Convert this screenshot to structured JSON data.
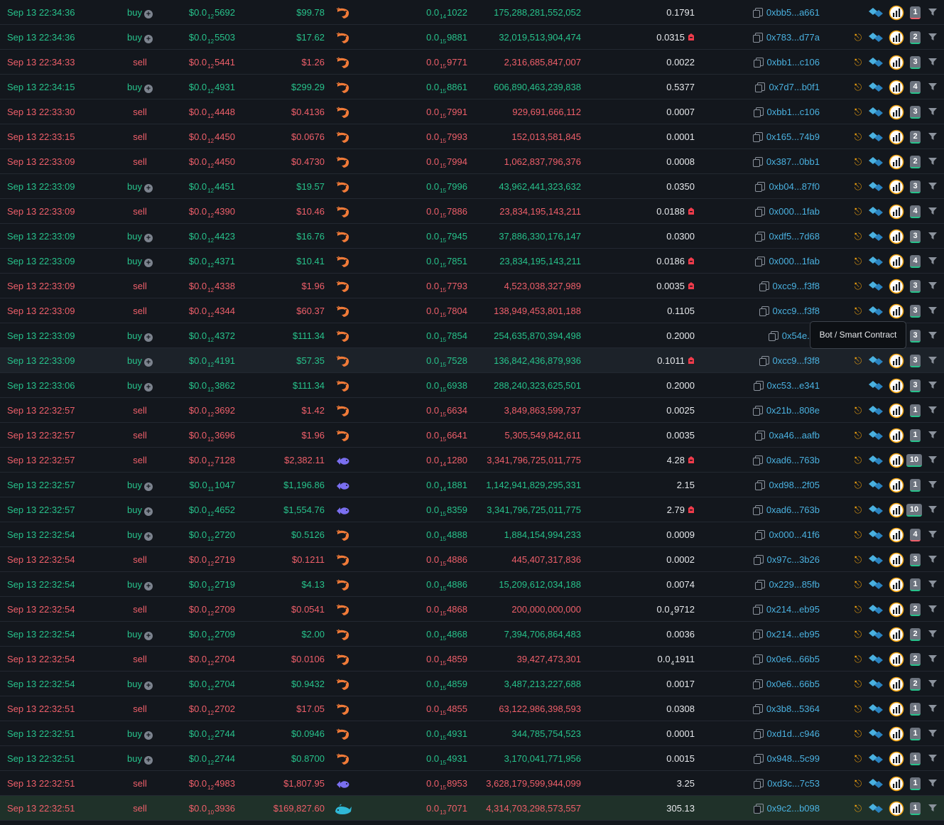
{
  "tooltip": "Bot / Smart Contract",
  "colors": {
    "buy": "#27c28b",
    "sell": "#ef5f6a",
    "wallet": "#4ab1e0",
    "shrimp": "#f07a38",
    "fish": "#7a6ff0",
    "whale": "#2fb8d6"
  },
  "rows": [
    {
      "date": "Sep 13 22:34:36",
      "type": "buy",
      "price_pre": "$0.0",
      "price_sub": "12",
      "price_post": "5692",
      "total": "$99.78",
      "maker_icon": "shrimp-icon",
      "native_pre": "0.0",
      "native_sub": "14",
      "native_post": "1022",
      "amount": "175,288,281,552,052",
      "eth": "0.1791",
      "pin": false,
      "wallet": "0xbb5...a661",
      "tree": false,
      "count": "1",
      "count_color": "red"
    },
    {
      "date": "Sep 13 22:34:36",
      "type": "buy",
      "price_pre": "$0.0",
      "price_sub": "12",
      "price_post": "5503",
      "total": "$17.62",
      "maker_icon": "shrimp-icon",
      "native_pre": "0.0",
      "native_sub": "15",
      "native_post": "9881",
      "amount": "32,019,513,904,474",
      "eth": "0.0315",
      "pin": true,
      "wallet": "0x783...d77a",
      "tree": true,
      "count": "2",
      "count_color": "green"
    },
    {
      "date": "Sep 13 22:34:33",
      "type": "sell",
      "price_pre": "$0.0",
      "price_sub": "12",
      "price_post": "5441",
      "total": "$1.26",
      "maker_icon": "shrimp-icon",
      "native_pre": "0.0",
      "native_sub": "15",
      "native_post": "9771",
      "amount": "2,316,685,847,007",
      "eth": "0.0022",
      "pin": false,
      "wallet": "0xbb1...c106",
      "tree": true,
      "count": "3",
      "count_color": "green"
    },
    {
      "date": "Sep 13 22:34:15",
      "type": "buy",
      "price_pre": "$0.0",
      "price_sub": "12",
      "price_post": "4931",
      "total": "$299.29",
      "maker_icon": "shrimp-icon",
      "native_pre": "0.0",
      "native_sub": "15",
      "native_post": "8861",
      "amount": "606,890,463,239,838",
      "eth": "0.5377",
      "pin": false,
      "wallet": "0x7d7...b0f1",
      "tree": true,
      "count": "4",
      "count_color": "green"
    },
    {
      "date": "Sep 13 22:33:30",
      "type": "sell",
      "price_pre": "$0.0",
      "price_sub": "12",
      "price_post": "4448",
      "total": "$0.4136",
      "maker_icon": "shrimp-icon",
      "native_pre": "0.0",
      "native_sub": "15",
      "native_post": "7991",
      "amount": "929,691,666,112",
      "eth": "0.0007",
      "pin": false,
      "wallet": "0xbb1...c106",
      "tree": true,
      "count": "3",
      "count_color": "green"
    },
    {
      "date": "Sep 13 22:33:15",
      "type": "sell",
      "price_pre": "$0.0",
      "price_sub": "12",
      "price_post": "4450",
      "total": "$0.0676",
      "maker_icon": "shrimp-icon",
      "native_pre": "0.0",
      "native_sub": "15",
      "native_post": "7993",
      "amount": "152,013,581,845",
      "eth": "0.0001",
      "pin": false,
      "wallet": "0x165...74b9",
      "tree": true,
      "count": "2",
      "count_color": "green"
    },
    {
      "date": "Sep 13 22:33:09",
      "type": "sell",
      "price_pre": "$0.0",
      "price_sub": "12",
      "price_post": "4450",
      "total": "$0.4730",
      "maker_icon": "shrimp-icon",
      "native_pre": "0.0",
      "native_sub": "15",
      "native_post": "7994",
      "amount": "1,062,837,796,376",
      "eth": "0.0008",
      "pin": false,
      "wallet": "0x387...0bb1",
      "tree": true,
      "count": "2",
      "count_color": "green"
    },
    {
      "date": "Sep 13 22:33:09",
      "type": "buy",
      "price_pre": "$0.0",
      "price_sub": "12",
      "price_post": "4451",
      "total": "$19.57",
      "maker_icon": "shrimp-icon",
      "native_pre": "0.0",
      "native_sub": "15",
      "native_post": "7996",
      "amount": "43,962,441,323,632",
      "eth": "0.0350",
      "pin": false,
      "wallet": "0xb04...87f0",
      "tree": true,
      "count": "3",
      "count_color": "green"
    },
    {
      "date": "Sep 13 22:33:09",
      "type": "sell",
      "price_pre": "$0.0",
      "price_sub": "12",
      "price_post": "4390",
      "total": "$10.46",
      "maker_icon": "shrimp-icon",
      "native_pre": "0.0",
      "native_sub": "15",
      "native_post": "7886",
      "amount": "23,834,195,143,211",
      "eth": "0.0188",
      "pin": true,
      "wallet": "0x000...1fab",
      "tree": true,
      "count": "4",
      "count_color": "green"
    },
    {
      "date": "Sep 13 22:33:09",
      "type": "buy",
      "price_pre": "$0.0",
      "price_sub": "12",
      "price_post": "4423",
      "total": "$16.76",
      "maker_icon": "shrimp-icon",
      "native_pre": "0.0",
      "native_sub": "15",
      "native_post": "7945",
      "amount": "37,886,330,176,147",
      "eth": "0.0300",
      "pin": false,
      "wallet": "0xdf5...7d68",
      "tree": true,
      "count": "3",
      "count_color": "green"
    },
    {
      "date": "Sep 13 22:33:09",
      "type": "buy",
      "price_pre": "$0.0",
      "price_sub": "12",
      "price_post": "4371",
      "total": "$10.41",
      "maker_icon": "shrimp-icon",
      "native_pre": "0.0",
      "native_sub": "15",
      "native_post": "7851",
      "amount": "23,834,195,143,211",
      "eth": "0.0186",
      "pin": true,
      "wallet": "0x000...1fab",
      "tree": true,
      "count": "4",
      "count_color": "green"
    },
    {
      "date": "Sep 13 22:33:09",
      "type": "sell",
      "price_pre": "$0.0",
      "price_sub": "12",
      "price_post": "4338",
      "total": "$1.96",
      "maker_icon": "shrimp-icon",
      "native_pre": "0.0",
      "native_sub": "15",
      "native_post": "7793",
      "amount": "4,523,038,327,989",
      "eth": "0.0035",
      "pin": true,
      "wallet": "0xcc9...f3f8",
      "tree": true,
      "count": "3",
      "count_color": "green"
    },
    {
      "date": "Sep 13 22:33:09",
      "type": "sell",
      "price_pre": "$0.0",
      "price_sub": "12",
      "price_post": "4344",
      "total": "$60.37",
      "maker_icon": "shrimp-icon",
      "native_pre": "0.0",
      "native_sub": "15",
      "native_post": "7804",
      "amount": "138,949,453,801,188",
      "eth": "0.1105",
      "pin": false,
      "wallet": "0xcc9...f3f8",
      "tree": true,
      "count": "3",
      "count_color": "green"
    },
    {
      "date": "Sep 13 22:33:09",
      "type": "buy",
      "price_pre": "$0.0",
      "price_sub": "12",
      "price_post": "4372",
      "total": "$111.34",
      "maker_icon": "shrimp-icon",
      "native_pre": "0.0",
      "native_sub": "15",
      "native_post": "7854",
      "amount": "254,635,870,394,498",
      "eth": "0.2000",
      "pin": false,
      "wallet": "0x54e...ff",
      "tree": false,
      "count": "3",
      "count_color": "green"
    },
    {
      "date": "Sep 13 22:33:09",
      "type": "buy",
      "price_pre": "$0.0",
      "price_sub": "12",
      "price_post": "4191",
      "total": "$57.35",
      "maker_icon": "shrimp-icon",
      "native_pre": "0.0",
      "native_sub": "15",
      "native_post": "7528",
      "amount": "136,842,436,879,936",
      "eth": "0.1011",
      "pin": true,
      "wallet": "0xcc9...f3f8",
      "tree": true,
      "count": "3",
      "count_color": "green"
    },
    {
      "date": "Sep 13 22:33:06",
      "type": "buy",
      "price_pre": "$0.0",
      "price_sub": "12",
      "price_post": "3862",
      "total": "$111.34",
      "maker_icon": "shrimp-icon",
      "native_pre": "0.0",
      "native_sub": "15",
      "native_post": "6938",
      "amount": "288,240,323,625,501",
      "eth": "0.2000",
      "pin": false,
      "wallet": "0xc53...e341",
      "tree": false,
      "count": "3",
      "count_color": "green"
    },
    {
      "date": "Sep 13 22:32:57",
      "type": "sell",
      "price_pre": "$0.0",
      "price_sub": "12",
      "price_post": "3692",
      "total": "$1.42",
      "maker_icon": "shrimp-icon",
      "native_pre": "0.0",
      "native_sub": "15",
      "native_post": "6634",
      "amount": "3,849,863,599,737",
      "eth": "0.0025",
      "pin": false,
      "wallet": "0x21b...808e",
      "tree": true,
      "count": "1",
      "count_color": "green"
    },
    {
      "date": "Sep 13 22:32:57",
      "type": "sell",
      "price_pre": "$0.0",
      "price_sub": "12",
      "price_post": "3696",
      "total": "$1.96",
      "maker_icon": "shrimp-icon",
      "native_pre": "0.0",
      "native_sub": "15",
      "native_post": "6641",
      "amount": "5,305,549,842,611",
      "eth": "0.0035",
      "pin": false,
      "wallet": "0xa46...aafb",
      "tree": true,
      "count": "1",
      "count_color": "green"
    },
    {
      "date": "Sep 13 22:32:57",
      "type": "sell",
      "price_pre": "$0.0",
      "price_sub": "12",
      "price_post": "7128",
      "total": "$2,382.11",
      "maker_icon": "fish-icon",
      "native_pre": "0.0",
      "native_sub": "14",
      "native_post": "1280",
      "amount": "3,341,796,725,011,775",
      "eth": "4.28",
      "pin": true,
      "wallet": "0xad6...763b",
      "tree": true,
      "count": "10",
      "count_color": "green"
    },
    {
      "date": "Sep 13 22:32:57",
      "type": "buy",
      "price_pre": "$0.0",
      "price_sub": "11",
      "price_post": "1047",
      "total": "$1,196.86",
      "maker_icon": "fish-icon",
      "native_pre": "0.0",
      "native_sub": "14",
      "native_post": "1881",
      "amount": "1,142,941,829,295,331",
      "eth": "2.15",
      "pin": false,
      "wallet": "0xd98...2f05",
      "tree": true,
      "count": "1",
      "count_color": "green"
    },
    {
      "date": "Sep 13 22:32:57",
      "type": "buy",
      "price_pre": "$0.0",
      "price_sub": "12",
      "price_post": "4652",
      "total": "$1,554.76",
      "maker_icon": "fish-icon",
      "native_pre": "0.0",
      "native_sub": "15",
      "native_post": "8359",
      "amount": "3,341,796,725,011,775",
      "eth": "2.79",
      "pin": true,
      "wallet": "0xad6...763b",
      "tree": true,
      "count": "10",
      "count_color": "green"
    },
    {
      "date": "Sep 13 22:32:54",
      "type": "buy",
      "price_pre": "$0.0",
      "price_sub": "12",
      "price_post": "2720",
      "total": "$0.5126",
      "maker_icon": "shrimp-icon",
      "native_pre": "0.0",
      "native_sub": "15",
      "native_post": "4888",
      "amount": "1,884,154,994,233",
      "eth": "0.0009",
      "pin": false,
      "wallet": "0x000...41f6",
      "tree": true,
      "count": "4",
      "count_color": "red"
    },
    {
      "date": "Sep 13 22:32:54",
      "type": "sell",
      "price_pre": "$0.0",
      "price_sub": "12",
      "price_post": "2719",
      "total": "$0.1211",
      "maker_icon": "shrimp-icon",
      "native_pre": "0.0",
      "native_sub": "15",
      "native_post": "4886",
      "amount": "445,407,317,836",
      "eth": "0.0002",
      "pin": false,
      "wallet": "0x97c...3b26",
      "tree": true,
      "count": "3",
      "count_color": "green"
    },
    {
      "date": "Sep 13 22:32:54",
      "type": "buy",
      "price_pre": "$0.0",
      "price_sub": "12",
      "price_post": "2719",
      "total": "$4.13",
      "maker_icon": "shrimp-icon",
      "native_pre": "0.0",
      "native_sub": "15",
      "native_post": "4886",
      "amount": "15,209,612,034,188",
      "eth": "0.0074",
      "pin": false,
      "wallet": "0x229...85fb",
      "tree": true,
      "count": "1",
      "count_color": "green"
    },
    {
      "date": "Sep 13 22:32:54",
      "type": "sell",
      "price_pre": "$0.0",
      "price_sub": "12",
      "price_post": "2709",
      "total": "$0.0541",
      "maker_icon": "shrimp-icon",
      "native_pre": "0.0",
      "native_sub": "15",
      "native_post": "4868",
      "amount": "200,000,000,000",
      "eth": "0.0",
      "eth_sub": "4",
      "eth_post": "9712",
      "pin": false,
      "wallet": "0x214...eb95",
      "tree": true,
      "count": "2",
      "count_color": "green"
    },
    {
      "date": "Sep 13 22:32:54",
      "type": "buy",
      "price_pre": "$0.0",
      "price_sub": "12",
      "price_post": "2709",
      "total": "$2.00",
      "maker_icon": "shrimp-icon",
      "native_pre": "0.0",
      "native_sub": "15",
      "native_post": "4868",
      "amount": "7,394,706,864,483",
      "eth": "0.0036",
      "pin": false,
      "wallet": "0x214...eb95",
      "tree": true,
      "count": "2",
      "count_color": "green"
    },
    {
      "date": "Sep 13 22:32:54",
      "type": "sell",
      "price_pre": "$0.0",
      "price_sub": "12",
      "price_post": "2704",
      "total": "$0.0106",
      "maker_icon": "shrimp-icon",
      "native_pre": "0.0",
      "native_sub": "15",
      "native_post": "4859",
      "amount": "39,427,473,301",
      "eth": "0.0",
      "eth_sub": "4",
      "eth_post": "1911",
      "pin": false,
      "wallet": "0x0e6...66b5",
      "tree": true,
      "count": "2",
      "count_color": "green"
    },
    {
      "date": "Sep 13 22:32:54",
      "type": "buy",
      "price_pre": "$0.0",
      "price_sub": "12",
      "price_post": "2704",
      "total": "$0.9432",
      "maker_icon": "shrimp-icon",
      "native_pre": "0.0",
      "native_sub": "15",
      "native_post": "4859",
      "amount": "3,487,213,227,688",
      "eth": "0.0017",
      "pin": false,
      "wallet": "0x0e6...66b5",
      "tree": true,
      "count": "2",
      "count_color": "green"
    },
    {
      "date": "Sep 13 22:32:51",
      "type": "sell",
      "price_pre": "$0.0",
      "price_sub": "12",
      "price_post": "2702",
      "total": "$17.05",
      "maker_icon": "shrimp-icon",
      "native_pre": "0.0",
      "native_sub": "15",
      "native_post": "4855",
      "amount": "63,122,986,398,593",
      "eth": "0.0308",
      "pin": false,
      "wallet": "0x3b8...5364",
      "tree": true,
      "count": "1",
      "count_color": "green"
    },
    {
      "date": "Sep 13 22:32:51",
      "type": "buy",
      "price_pre": "$0.0",
      "price_sub": "12",
      "price_post": "2744",
      "total": "$0.0946",
      "maker_icon": "shrimp-icon",
      "native_pre": "0.0",
      "native_sub": "15",
      "native_post": "4931",
      "amount": "344,785,754,523",
      "eth": "0.0001",
      "pin": false,
      "wallet": "0xd1d...c946",
      "tree": true,
      "count": "1",
      "count_color": "green"
    },
    {
      "date": "Sep 13 22:32:51",
      "type": "buy",
      "price_pre": "$0.0",
      "price_sub": "12",
      "price_post": "2744",
      "total": "$0.8700",
      "maker_icon": "shrimp-icon",
      "native_pre": "0.0",
      "native_sub": "15",
      "native_post": "4931",
      "amount": "3,170,041,771,956",
      "eth": "0.0015",
      "pin": false,
      "wallet": "0x948...5c99",
      "tree": true,
      "count": "1",
      "count_color": "green"
    },
    {
      "date": "Sep 13 22:32:51",
      "type": "sell",
      "price_pre": "$0.0",
      "price_sub": "12",
      "price_post": "4983",
      "total": "$1,807.95",
      "maker_icon": "fish-icon",
      "native_pre": "0.0",
      "native_sub": "15",
      "native_post": "8953",
      "amount": "3,628,179,599,944,099",
      "eth": "3.25",
      "pin": false,
      "wallet": "0xd3c...7c53",
      "tree": true,
      "count": "1",
      "count_color": "green"
    },
    {
      "date": "Sep 13 22:32:51",
      "type": "sell",
      "price_pre": "$0.0",
      "price_sub": "10",
      "price_post": "3936",
      "total": "$169,827.60",
      "maker_icon": "whale-icon",
      "native_pre": "0.0",
      "native_sub": "13",
      "native_post": "7071",
      "amount": "4,314,703,298,573,557",
      "eth": "305.13",
      "pin": false,
      "wallet": "0x9c2...b098",
      "tree": true,
      "count": "1",
      "count_color": "green"
    }
  ]
}
